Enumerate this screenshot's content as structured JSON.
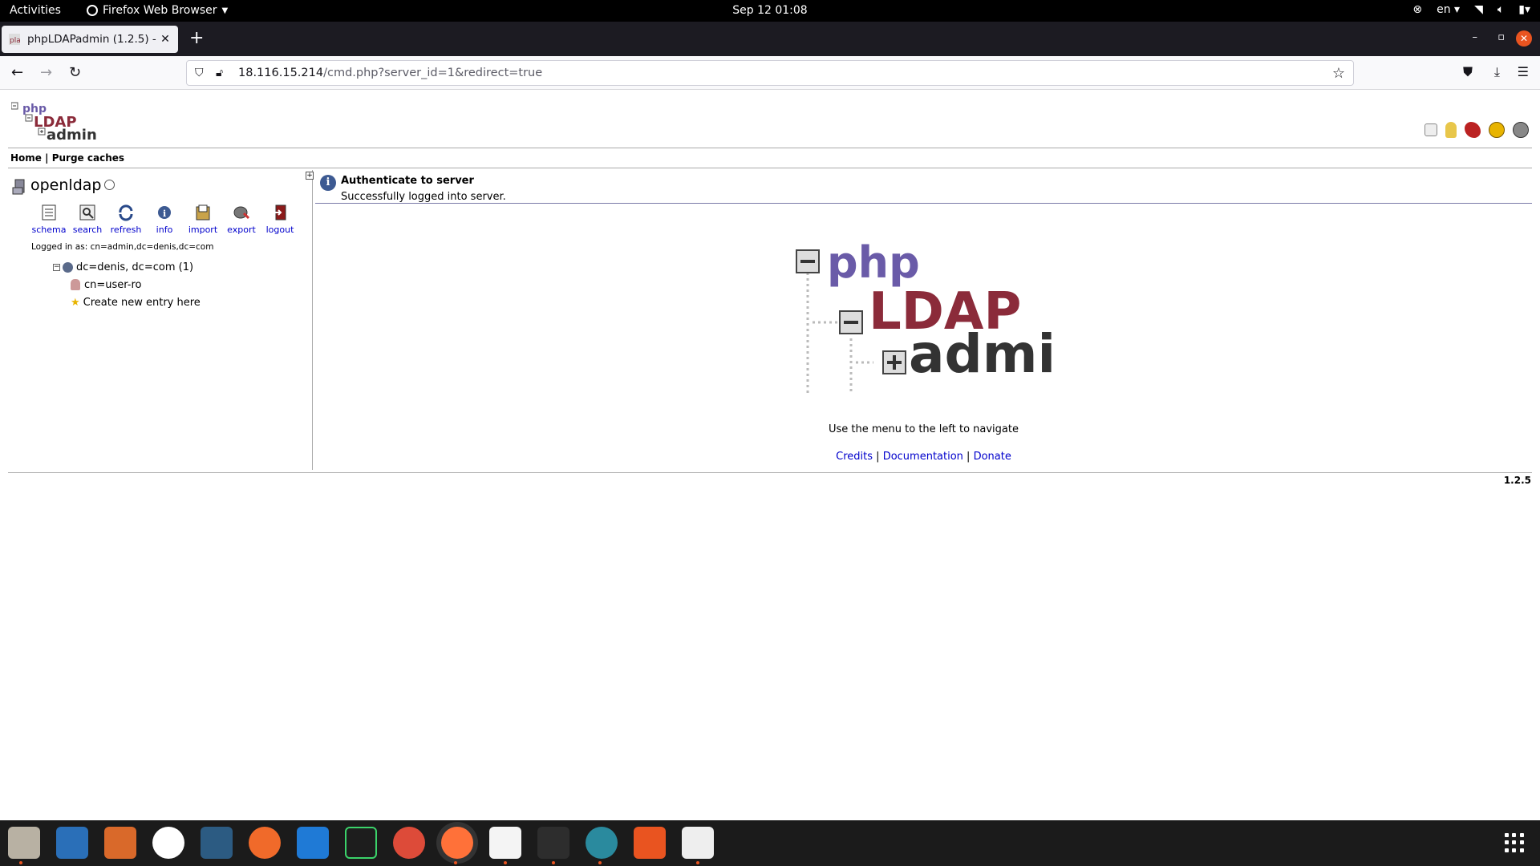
{
  "topbar": {
    "activities": "Activities",
    "app_name": "Firefox Web Browser",
    "clock": "Sep 12  01:08",
    "language": "en"
  },
  "browser": {
    "tab_title": "phpLDAPadmin (1.2.5) -",
    "url_host": "18.116.15.214",
    "url_path": "/cmd.php?server_id=1&redirect=true"
  },
  "page": {
    "menu": {
      "home": "Home",
      "separator": "|",
      "purge": "Purge caches"
    },
    "server": {
      "name": "openldap",
      "tools": [
        {
          "label": "schema",
          "icon": "schema-icon"
        },
        {
          "label": "search",
          "icon": "search-icon"
        },
        {
          "label": "refresh",
          "icon": "refresh-icon"
        },
        {
          "label": "info",
          "icon": "info-icon"
        },
        {
          "label": "import",
          "icon": "import-icon"
        },
        {
          "label": "export",
          "icon": "export-icon"
        },
        {
          "label": "logout",
          "icon": "logout-icon"
        }
      ],
      "logged_in": "Logged in as: cn=admin,dc=denis,dc=com",
      "tree": {
        "base": "dc=denis, dc=com (1)",
        "children": [
          "cn=user-ro",
          "Create new entry here"
        ]
      }
    },
    "notice": {
      "title": "Authenticate to server",
      "body": "Successfully logged into server."
    },
    "navigate_msg": "Use the menu to the left to navigate",
    "links": {
      "credits": "Credits",
      "documentation": "Documentation",
      "donate": "Donate",
      "sep": "|"
    },
    "version": "1.2.5"
  },
  "colors": {
    "php_purple": "#6a5ba8",
    "ldap_red": "#8b2b3a",
    "admin_dark": "#333333",
    "link_blue": "#0000cc",
    "ubuntu_orange": "#e95420"
  }
}
